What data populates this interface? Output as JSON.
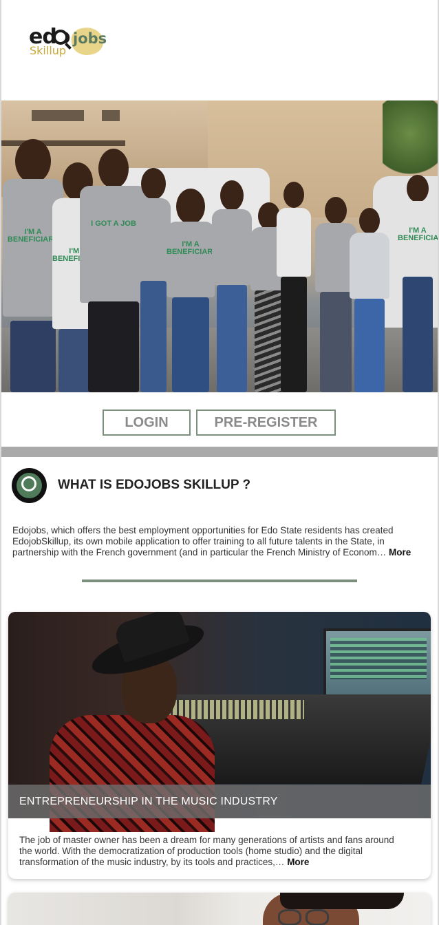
{
  "logo": {
    "edo": "edo",
    "jobs": "jobs",
    "skillup": "Skillup",
    "alt_name": "edojobs-skillup-logo"
  },
  "hero": {
    "shirts": [
      "I'M A BENEFICIARY",
      "I'M A BENEFICIARY",
      "I GOT A JOB",
      "I'M A BENEFICIARY",
      "I'M A BENEFICIARY"
    ]
  },
  "buttons": {
    "login": "LOGIN",
    "preregister": "PRE-REGISTER"
  },
  "what": {
    "title": "WHAT IS EDOJOBS SKILLUP ?",
    "text_line1": "Edojobs, which offers the best employment opportunities for Edo State residents has created",
    "text_line2": "EdojobSkillup, its own mobile application to offer training to all future talents in the State, in",
    "text_line3": "partnership with the French government (and in particular the French Ministry of Econom…",
    "more": "More"
  },
  "cards": [
    {
      "caption": "ENTREPRENEURSHIP IN THE MUSIC INDUSTRY",
      "text_line1": "The job of master owner has been a dream for many generations of artists and fans around",
      "text_line2": "the world. With the democratization of production tools (home studio) and the digital",
      "text_line3": "transformation of the music industry, by its tools and practices,…",
      "more": "More"
    }
  ],
  "colors": {
    "accent_green": "#7a8f7c",
    "gray_bar": "#aaaaaa",
    "logo_gold": "#c8a838",
    "logo_green": "#5b7a5f"
  }
}
